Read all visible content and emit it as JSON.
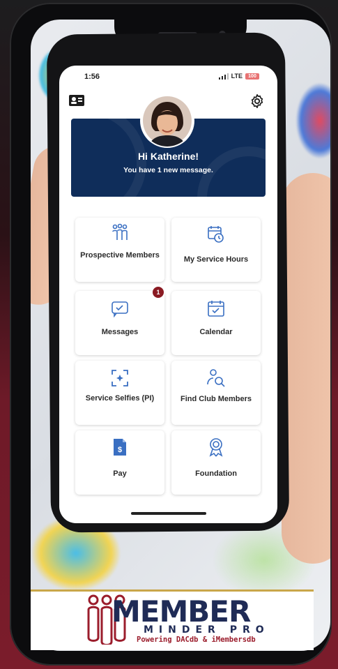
{
  "status_bar": {
    "time": "1:56",
    "network": "LTE",
    "battery": "100"
  },
  "header": {
    "greeting": "Hi Katherine!",
    "message": "You have 1 new message."
  },
  "tiles": [
    {
      "label": "Prospective Members",
      "icon": "people-group-icon"
    },
    {
      "label": "My Service Hours",
      "icon": "calendar-clock-icon"
    },
    {
      "label": "Messages",
      "icon": "message-icon",
      "badge": "1"
    },
    {
      "label": "Calendar",
      "icon": "calendar-check-icon"
    },
    {
      "label": "Service Selfies (PI)",
      "icon": "selfie-frame-icon"
    },
    {
      "label": "Find Club Members",
      "icon": "find-person-icon"
    },
    {
      "label": "Pay",
      "icon": "pay-document-icon"
    },
    {
      "label": "Foundation",
      "icon": "award-ribbon-icon"
    }
  ],
  "brand": {
    "line1": "MEMBER",
    "line2": "MINDER PRO",
    "line3": "Powering DACdb & iMembersdb",
    "colors": {
      "navy": "#1f2b56",
      "maroon": "#9b1d2c",
      "banner": "#0f2d5a",
      "icon_blue": "#3a6fc2"
    }
  }
}
